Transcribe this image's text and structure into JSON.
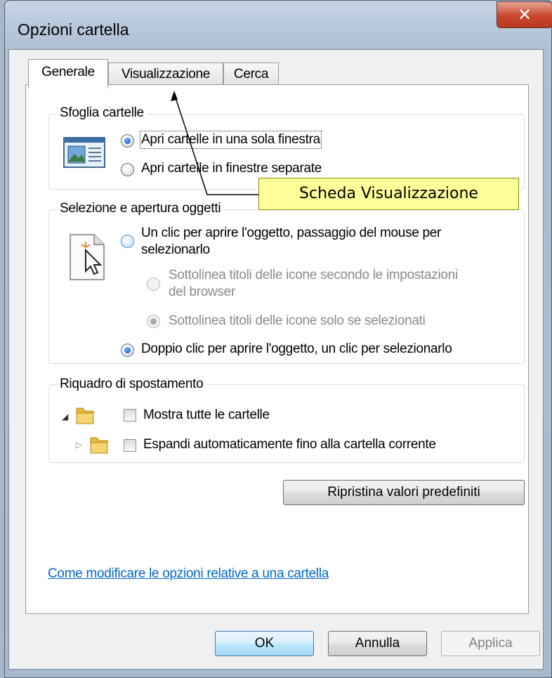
{
  "window": {
    "title": "Opzioni cartella"
  },
  "tabs": [
    {
      "label": "Generale"
    },
    {
      "label": "Visualizzazione"
    },
    {
      "label": "Cerca"
    }
  ],
  "browse": {
    "title": "Sfoglia cartelle",
    "option1": "Apri cartelle in una sola finestra",
    "option2": "Apri cartelle in finestre separate"
  },
  "click": {
    "title": "Selezione e apertura oggetti",
    "single_line1": "Un clic per aprire l'oggetto, passaggio del mouse per",
    "single_line2": "selezionarlo",
    "sub1_line1": "Sottolinea titoli delle icone secondo le impostazioni",
    "sub1_line2": "del browser",
    "sub2": "Sottolinea titoli delle icone solo se selezionati",
    "double": "Doppio clic per aprire l'oggetto, un clic per selezionarlo"
  },
  "nav": {
    "title": "Riquadro di spostamento",
    "show_all": "Mostra tutte le cartelle",
    "auto_expand": "Espandi automaticamente fino alla cartella corrente"
  },
  "restore_button": "Ripristina valori predefiniti",
  "help_link": "Come modificare le opzioni relative a una cartella",
  "buttons": {
    "ok": "OK",
    "cancel": "Annulla",
    "apply": "Applica"
  },
  "callout": "Scheda Visualizzazione",
  "colors": {
    "callout_bg": "#ffff99",
    "link": "#0066cc",
    "close_button": "#c9462c"
  }
}
